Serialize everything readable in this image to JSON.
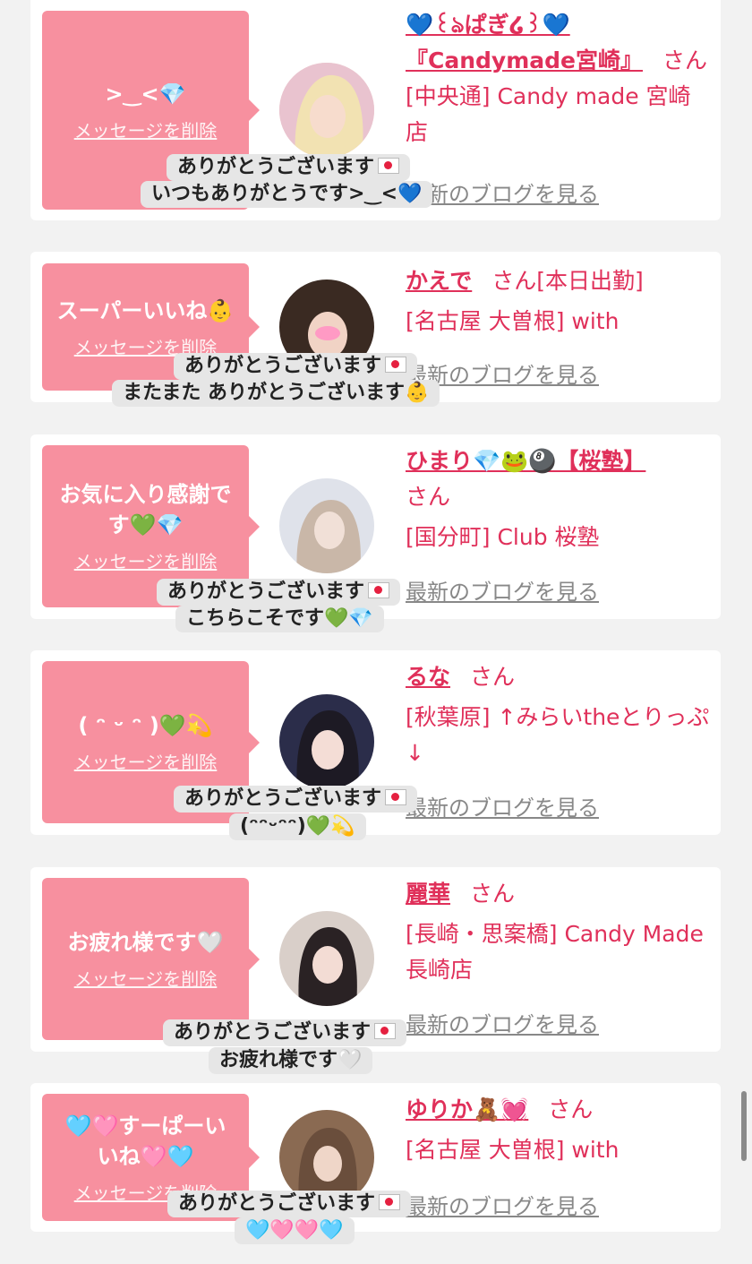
{
  "cards": [
    {
      "bubble_text": ">‿<💎",
      "delete_label": "メッセージを削除",
      "name": "💙꒰ঌぱぎ໒꒱💙 『Candymade宮崎』",
      "san": "さん",
      "shop": "[中央通] Candy made 宮崎店",
      "blog_label": "最新のブログを見る",
      "reply_line1": "ありがとうございます",
      "reply_line2": "いつもありがとうです>‿<💙"
    },
    {
      "bubble_text": "スーパーいいね👶",
      "delete_label": "メッセージを削除",
      "name": "かえで",
      "san": "さん[本日出勤]",
      "shop": "[名古屋 大曽根] with",
      "blog_label": "最新のブログを見る",
      "reply_line1": "ありがとうございます",
      "reply_line2": "またまた ありがとうございます👶"
    },
    {
      "bubble_text": "お気に入り感謝です💚💎",
      "delete_label": "メッセージを削除",
      "name": "ひまり💎🐸🎱【桜塾】",
      "san": "さん",
      "shop": "[国分町] Club 桜塾",
      "blog_label": "最新のブログを見る",
      "reply_line1": "ありがとうございます",
      "reply_line2": "こちらこそです💚💎"
    },
    {
      "bubble_text": "( ᵔ ᵕ ᵔ )💚💫",
      "delete_label": "メッセージを削除",
      "name": "るな",
      "san": "さん",
      "shop": "[秋葉原] ↑みらいtheとりっぷ↓",
      "blog_label": "最新のブログを見る",
      "reply_line1": "ありがとうございます",
      "reply_line2": "(ᵔᵔᵕᵔᵔ)💚💫"
    },
    {
      "bubble_text": "お疲れ様です🤍",
      "delete_label": "メッセージを削除",
      "name": "麗華",
      "san": "さん",
      "shop": "[長崎・思案橋] Candy Made 長崎店",
      "blog_label": "最新のブログを見る",
      "reply_line1": "ありがとうございます",
      "reply_line2": "お疲れ様です🤍"
    },
    {
      "bubble_text": "🩵🩷すーぱーいいね🩷🩵",
      "delete_label": "メッセージを削除",
      "name": "ゆりか🧸💓",
      "san": "さん",
      "shop": "[名古屋 大曽根] with",
      "blog_label": "最新のブログを見る",
      "reply_line1": "ありがとうございます",
      "reply_line2": "🩵🩷🩷🩵"
    }
  ],
  "colors": {
    "accent": "#e0305a",
    "bubble": "#f7909f",
    "background": "#f2f2f2"
  }
}
